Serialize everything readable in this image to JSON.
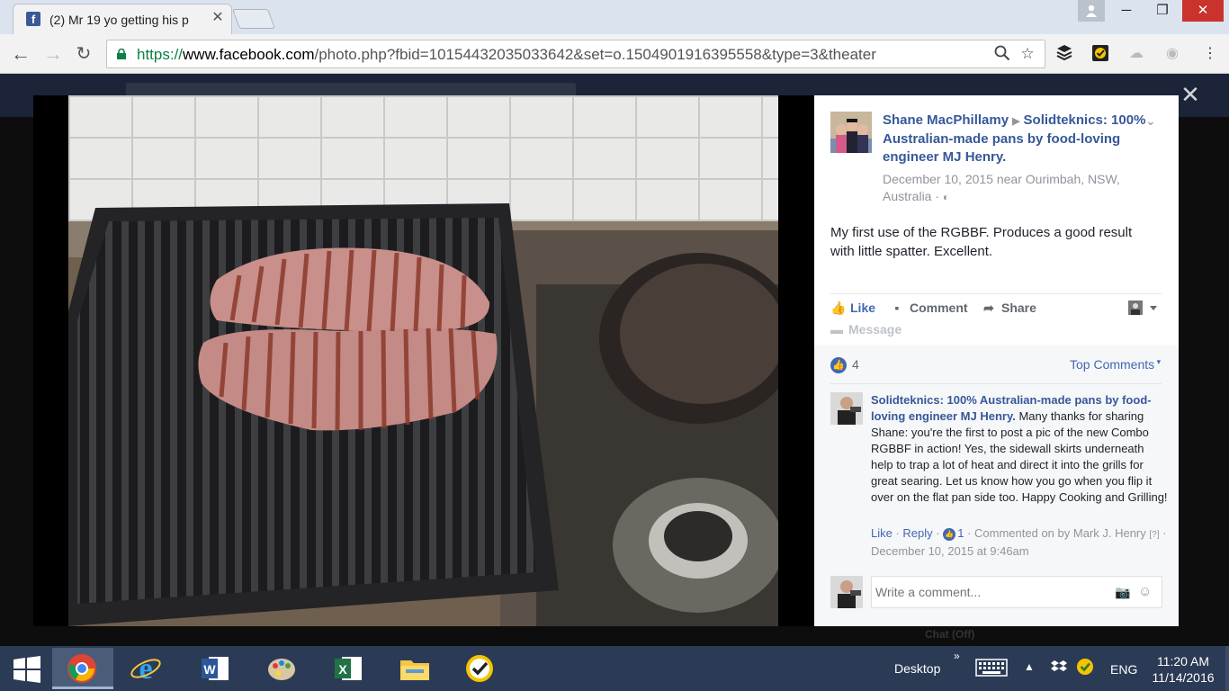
{
  "browser": {
    "tab_title": "(2) Mr 19 yo getting his p",
    "tab_favicon": "f",
    "url_scheme": "https://",
    "url_host": "www.facebook.com",
    "url_path": "/photo.php?fbid=10154432035033642&set=o.1504901916395558&type=3&theater"
  },
  "post": {
    "author": "Shane MacPhillamy",
    "page": "Solidteknics: 100% Australian-made pans by food-loving engineer MJ Henry.",
    "meta": "December 10, 2015 near Ourimbah, NSW, Australia · ",
    "text": "My first use of the RGBBF. Produces a good result with little spatter. Excellent.",
    "actions": {
      "like": "Like",
      "comment": "Comment",
      "share": "Share",
      "message": "Message"
    },
    "reaction_count": "4",
    "top_comments": "Top Comments"
  },
  "comment": {
    "author": "Solidteknics: 100% Australian-made pans by food-loving engineer MJ Henry.",
    "text": " Many thanks for sharing Shane: you're the first to post a pic of the new Combo RGBBF in action! Yes, the sidewall skirts underneath help to trap a lot of heat and direct it into the grills for great searing. Let us know how you go when you flip it over on the flat pan side too. Happy Cooking and Grilling!",
    "like": "Like",
    "reply": "Reply",
    "like_count": "1",
    "commented_on_by": "Commented on by Mark J. Henry",
    "help_mark": "[?]",
    "date": "December 10, 2015 at 9:46am",
    "placeholder": "Write a comment..."
  },
  "background": {
    "chat": "Chat (Off)"
  },
  "taskbar": {
    "desktop": "Desktop",
    "lang": "ENG",
    "time": "11:20 AM",
    "date": "11/14/2016"
  },
  "icons": [
    "facebook-icon",
    "back-icon",
    "forward-icon",
    "reload-icon",
    "lock-icon",
    "search-icon",
    "star-icon",
    "close-icon",
    "globe-icon",
    "like-icon",
    "comment-icon",
    "share-icon",
    "camera-icon",
    "smile-icon",
    "windows-icon",
    "chrome-icon",
    "ie-icon",
    "word-icon",
    "paint-icon",
    "excel-icon",
    "folder-icon",
    "norton-icon",
    "keyboard-icon"
  ],
  "colors": {
    "fb_link": "#365899",
    "fb_blue": "#4267b2",
    "taskbar": "#2b3a55"
  }
}
